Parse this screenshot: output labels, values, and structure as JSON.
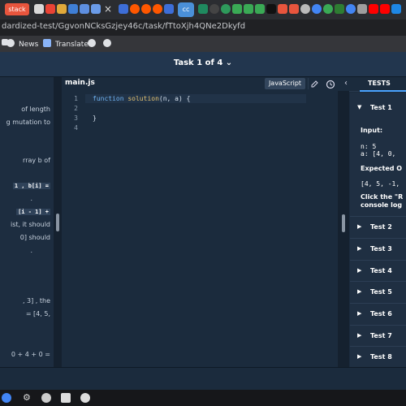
{
  "browser": {
    "first_tab_label": "stack",
    "active_tab_label": "cc",
    "close_glyph": "×",
    "url": "dardized-test/GgvonNCksGzjey46c/task/fTtoXjh4QNe2Dkyfd",
    "bookmarks": [
      {
        "label": "News",
        "icon": "news-icon"
      },
      {
        "label": "Translate",
        "icon": "translate-icon"
      },
      {
        "label": "",
        "icon": "globe-icon"
      },
      {
        "label": "",
        "icon": "globe-icon"
      }
    ]
  },
  "header": {
    "task_title": "Task 1 of 4",
    "chevron": "⌄"
  },
  "description": {
    "lines": [
      "of length",
      "g mutation to",
      "",
      "rray  b  of",
      "",
      "1 , b[i] =",
      ".",
      "[i - 1] +",
      "ist, it should",
      "0]  should",
      ".",
      "",
      "",
      ", 3] , the",
      "= [4, 5,",
      "",
      "",
      "0 + 4 + 0 ="
    ]
  },
  "editor": {
    "file_name": "main.js",
    "language": "JavaScript",
    "line_numbers": [
      "1",
      "2",
      "3",
      "4"
    ],
    "code_lines": [
      "function solution(n, a) {",
      "",
      "}",
      ""
    ]
  },
  "tests": {
    "title": "TESTS",
    "items": [
      "Test 1",
      "Test 2",
      "Test 3",
      "Test 4",
      "Test 5",
      "Test 6",
      "Test 7",
      "Test 8"
    ],
    "test1": {
      "input_label": "Input:",
      "n_line": "n: 5",
      "a_line": "a: [4, 0,",
      "expected_label": "Expected O",
      "expected_value": "[4, 5, -1,",
      "note_line1": "Click the \"R",
      "note_line2": "console log"
    }
  },
  "colors": {
    "accent": "#4aa3ff",
    "header_bg": "#22364e",
    "panel_bg": "#1b2b3d"
  }
}
